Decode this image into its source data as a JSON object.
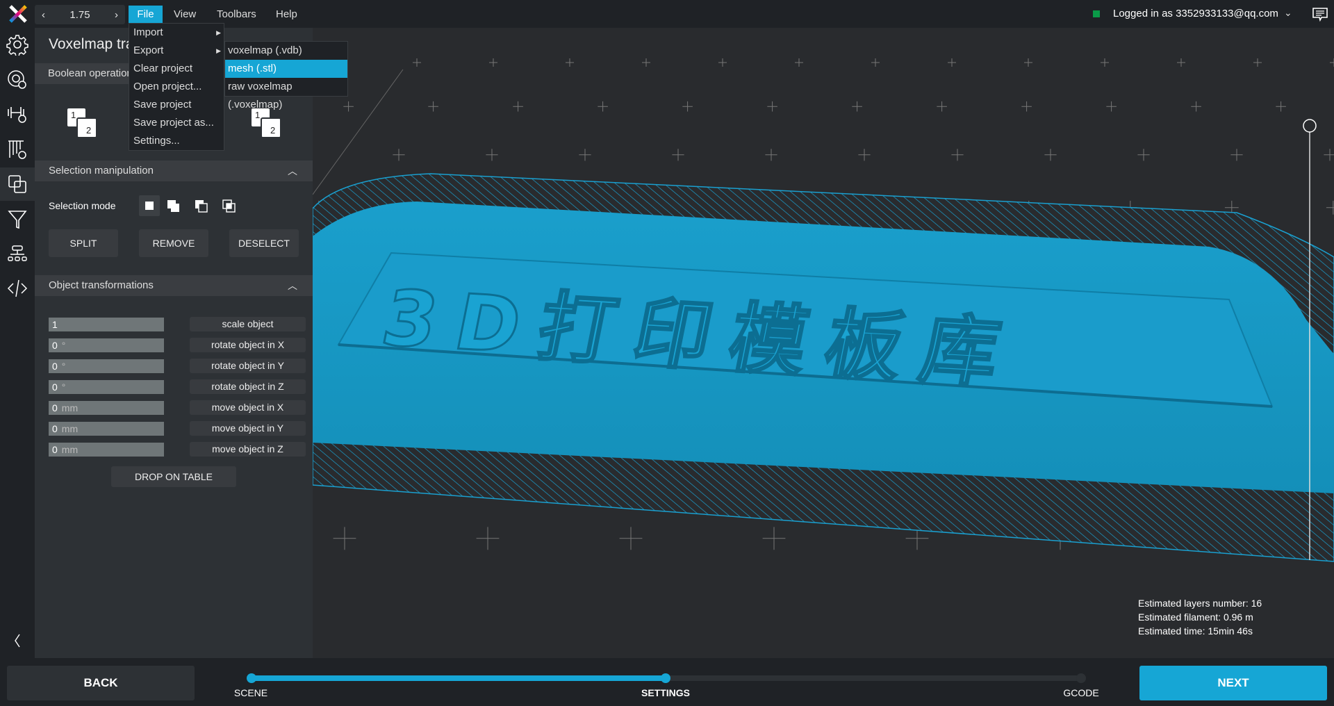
{
  "topbar": {
    "zoom_value": "1.75",
    "menus": [
      "File",
      "View",
      "Toolbars",
      "Help"
    ],
    "active_menu": "File",
    "login_text": "Logged in as 3352933133@qq.com",
    "status_color": "#0a9a48"
  },
  "file_menu": {
    "items": [
      {
        "label": "Import",
        "submenu": true
      },
      {
        "label": "Export",
        "submenu": true
      },
      {
        "label": "Clear project"
      },
      {
        "label": "Open project..."
      },
      {
        "label": "Save project"
      },
      {
        "label": "Save project as..."
      },
      {
        "label": "Settings..."
      }
    ]
  },
  "export_submenu": {
    "items": [
      "voxelmap (.vdb)",
      "mesh (.stl)",
      "raw voxelmap (.voxelmap)"
    ],
    "highlighted": "mesh (.stl)"
  },
  "sidebar": {
    "icons": [
      "settings-icon",
      "print-settings-icon",
      "support-settings-icon",
      "infill-settings-icon",
      "voxelmap-icon",
      "filter-icon",
      "hierarchy-icon",
      "code-icon"
    ],
    "selected": "voxelmap-icon"
  },
  "panel": {
    "title": "Voxelmap tra",
    "boolean": {
      "header": "Boolean operation",
      "labels": [
        "1",
        "2"
      ]
    },
    "selection": {
      "header": "Selection manipulation",
      "mode_label": "Selection mode",
      "buttons": [
        "SPLIT",
        "REMOVE",
        "DESELECT"
      ]
    },
    "transform": {
      "header": "Object transformations",
      "rows": [
        {
          "value": "1",
          "unit": "",
          "action": "scale object"
        },
        {
          "value": "0",
          "unit": "°",
          "action": "rotate object in X"
        },
        {
          "value": "0",
          "unit": "°",
          "action": "rotate object in Y"
        },
        {
          "value": "0",
          "unit": "°",
          "action": "rotate object in Z"
        },
        {
          "value": "0",
          "unit": "mm",
          "action": "move object in X"
        },
        {
          "value": "0",
          "unit": "mm",
          "action": "move object in Y"
        },
        {
          "value": "0",
          "unit": "mm",
          "action": "move object in Z"
        }
      ],
      "drop_button": "DROP ON TABLE"
    }
  },
  "viewport": {
    "model_text": "3D打印模板库",
    "model_color": "#1697c4",
    "stats": [
      "Estimated layers number: 16",
      "Estimated filament: 0.96 m",
      "Estimated time: 15min 46s"
    ]
  },
  "bottom": {
    "back": "BACK",
    "next": "NEXT",
    "steps": [
      "SCENE",
      "SETTINGS",
      "GCODE"
    ],
    "current_step": "SETTINGS",
    "accent": "#16a6d5"
  }
}
